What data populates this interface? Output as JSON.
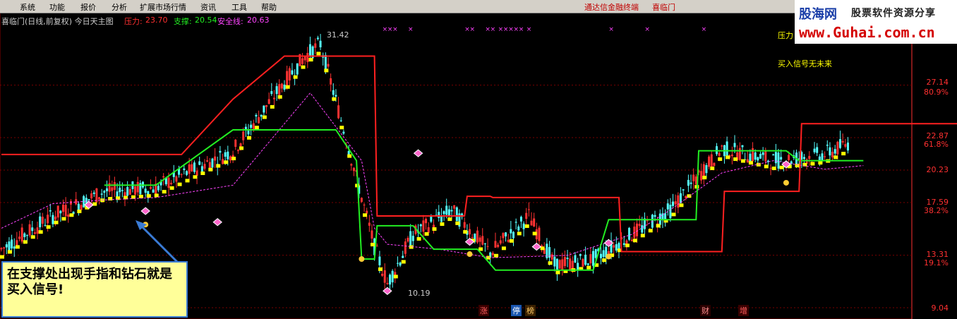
{
  "menubar": {
    "items": [
      "系统",
      "功能",
      "报价",
      "分析",
      "扩展市场行情",
      "资讯",
      "工具",
      "帮助"
    ],
    "promo": [
      "通达信金融终端",
      "喜临门"
    ]
  },
  "logo": {
    "main": "股海网",
    "sub": "股票软件资源分享",
    "url": "www.Guhai.com.cn"
  },
  "header": {
    "title": "喜临门(日线,前复权) 今日天主图",
    "pressure_label": "压力:",
    "pressure_value": "23.70",
    "support_label": "支撑:",
    "support_value": "20.54",
    "safety_label": "安全线:",
    "safety_value": "20.63"
  },
  "side_text": {
    "line1": "压力",
    "line2": "买入信号无未来"
  },
  "price_annotations": {
    "high": "31.42",
    "low": "10.19"
  },
  "axis": {
    "prices": [
      "27.14",
      "22.87",
      "20.23",
      "17.59",
      "13.31",
      "9.04"
    ],
    "percents": [
      "80.9%",
      "61.8%",
      "38.2%",
      "19.1%"
    ]
  },
  "events": [
    "涨",
    "停",
    "榜",
    "财",
    "增"
  ],
  "callout": {
    "text": "在支撑处出现手指和钻石就是买入信号!"
  },
  "colors": {
    "up": "#ff3232",
    "down": "#54ffff",
    "pressure": "#ff2020",
    "support": "#22ee22",
    "safety": "#ff44ff",
    "trend": "#ffff00",
    "axis": "#ff3030",
    "callout_border": "#3a7bd5"
  },
  "chart_data": {
    "type": "candlestick",
    "ylim": [
      9.04,
      31.42
    ],
    "y_axis_ticks": [
      27.14,
      22.87,
      20.23,
      17.59,
      13.31,
      9.04
    ],
    "fib_levels": [
      "80.9%",
      "61.8%",
      "38.2%",
      "19.1%"
    ],
    "high": 31.42,
    "low": 10.19,
    "pressure_line": [
      [
        0,
        21.5
      ],
      [
        20,
        21.5
      ],
      [
        40,
        21.5
      ],
      [
        70,
        21.5
      ],
      [
        90,
        26.0
      ],
      [
        110,
        29.5
      ],
      [
        145,
        29.5
      ],
      [
        146,
        16.5
      ],
      [
        180,
        16.5
      ],
      [
        181,
        18.1
      ],
      [
        190,
        18.1
      ],
      [
        191,
        18.0
      ],
      [
        240,
        18.0
      ],
      [
        241,
        13.6
      ],
      [
        280,
        13.6
      ],
      [
        281,
        18.5
      ],
      [
        310,
        18.5
      ],
      [
        311,
        24.0
      ],
      [
        354,
        24.0
      ],
      [
        380,
        24.0
      ]
    ],
    "support_line": [
      [
        40,
        19.0
      ],
      [
        60,
        19.0
      ],
      [
        90,
        23.5
      ],
      [
        120,
        23.5
      ],
      [
        130,
        23.5
      ],
      [
        138,
        21.0
      ],
      [
        140,
        13.0
      ],
      [
        145,
        13.0
      ],
      [
        146,
        15.7
      ],
      [
        160,
        15.7
      ],
      [
        168,
        13.8
      ],
      [
        185,
        13.8
      ],
      [
        192,
        12.1
      ],
      [
        230,
        12.1
      ],
      [
        236,
        16.2
      ],
      [
        260,
        16.2
      ],
      [
        270,
        16.2
      ],
      [
        271,
        21.8
      ],
      [
        296,
        21.8
      ],
      [
        305,
        21.8
      ],
      [
        310,
        21.0
      ],
      [
        335,
        21.0
      ]
    ],
    "safety_line": [
      [
        0,
        15.5
      ],
      [
        20,
        17.5
      ],
      [
        40,
        17.8
      ],
      [
        60,
        18.0
      ],
      [
        90,
        19.0
      ],
      [
        110,
        24.0
      ],
      [
        120,
        26.5
      ],
      [
        140,
        21.0
      ],
      [
        145,
        15.5
      ],
      [
        150,
        14.2
      ],
      [
        170,
        13.8
      ],
      [
        190,
        13.1
      ],
      [
        220,
        13.3
      ],
      [
        245,
        15.0
      ],
      [
        260,
        17.0
      ],
      [
        280,
        20.0
      ],
      [
        300,
        21.0
      ],
      [
        320,
        20.3
      ],
      [
        335,
        20.6
      ]
    ]
  }
}
